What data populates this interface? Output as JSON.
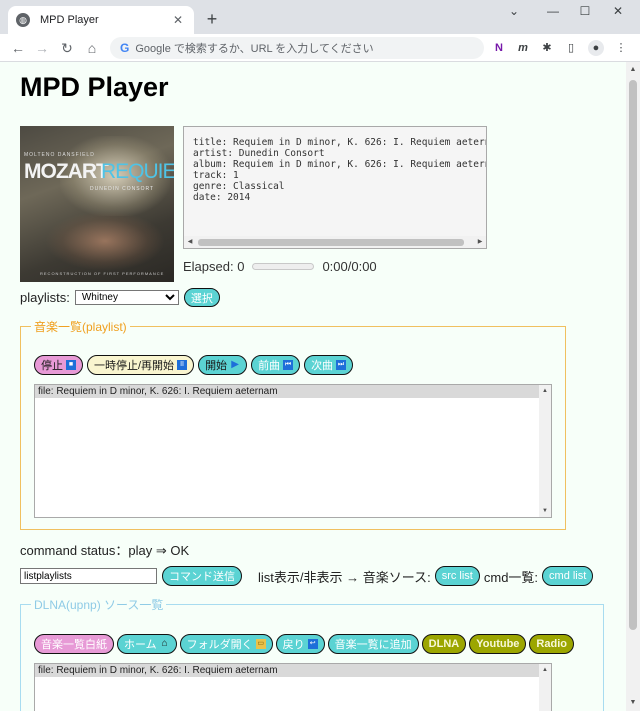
{
  "browser": {
    "tab_title": "MPD Player",
    "new_tab": "+",
    "omnibox_placeholder": "Google で検索するか、URL を入力してください",
    "window_controls": [
      "⌄",
      "—",
      "☐",
      "✕"
    ]
  },
  "page": {
    "title": "MPD Player",
    "album_art": {
      "small_text": "MOLTENO DANSFIELD",
      "main_left": "MOZART",
      "main_right": "REQUIEM",
      "sub": "DUNEDIN CONSORT",
      "bottom": "RECONSTRUCTION OF FIRST PERFORMANCE"
    },
    "metadata_lines": "title: Requiem in D minor, K. 626: I. Requiem aeternam\nartist: Dunedin Consort\nalbum: Requiem in D minor, K. 626: I. Requiem aeternam\ntrack: 1\ngenre: Classical\ndate: 2014",
    "elapsed_label": "Elapsed: 0",
    "elapsed_progress": 0,
    "elapsed_time": "0:00/0:00",
    "playlists_label": "playlists:",
    "playlist_selected": "Whitney",
    "select_button": "選択",
    "playlist_group": {
      "legend": "音楽一覧(playlist)",
      "buttons": [
        {
          "label": "停止",
          "icon": "■"
        },
        {
          "label": "一時停止/再開始",
          "icon": "II"
        },
        {
          "label": "開始",
          "icon": "▶"
        },
        {
          "label": "前曲",
          "icon": "⏮"
        },
        {
          "label": "次曲",
          "icon": "⏭"
        }
      ],
      "list_items": [
        "file: Requiem in D minor, K. 626: I. Requiem aeternam"
      ]
    },
    "command_status": "command status：play ⇒ OK",
    "command_input": "listplaylists",
    "command_send": "コマンド送信",
    "list_toggle": "list表示/非表示 → 音楽ソース:",
    "src_list": "src list",
    "cmd_label": "cmd一覧:",
    "cmd_list": "cmd list",
    "dlna_group": {
      "legend": "DLNA(upnp) ソース一覧",
      "buttons": [
        {
          "label": "音楽一覧白紙"
        },
        {
          "label": "ホーム",
          "icon": "⌂"
        },
        {
          "label": "フォルダ開く",
          "icon": "▭"
        },
        {
          "label": "戻り",
          "icon": "↩"
        },
        {
          "label": "音楽一覧に追加"
        },
        {
          "label": "DLNA"
        },
        {
          "label": "Youtube"
        },
        {
          "label": "Radio"
        }
      ],
      "list_items": [
        "file: Requiem in D minor, K. 626: I. Requiem aeternam"
      ]
    }
  },
  "colors": {
    "page_bg": "#f7fff9",
    "playlist_border": "#f0c060",
    "playlist_legend": "#f0a020",
    "dlna_border": "#a8dcf0",
    "dlna_legend": "#8fcbe6",
    "pill_teal": "#5bd3d3",
    "pill_pink": "#e79ad6",
    "pill_olive": "#9ca600"
  }
}
